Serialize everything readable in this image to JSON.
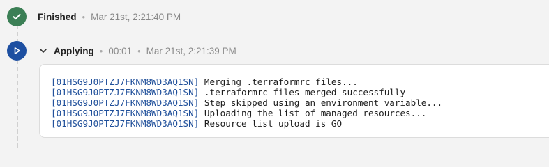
{
  "steps": {
    "finished": {
      "icon": "check-icon",
      "label": "Finished",
      "timestamp": "Mar 21st, 2:21:40 PM"
    },
    "applying": {
      "icon": "play-icon",
      "label": "Applying",
      "duration": "00:01",
      "timestamp": "Mar 21st, 2:21:39 PM",
      "expanded": true
    }
  },
  "log": {
    "lines": [
      {
        "id": "[01HSG9J0PTZJ7FKNM8WD3AQ1SN]",
        "message": "Merging .terraformrc files..."
      },
      {
        "id": "[01HSG9J0PTZJ7FKNM8WD3AQ1SN]",
        "message": ".terraformrc files merged successfully"
      },
      {
        "id": "[01HSG9J0PTZJ7FKNM8WD3AQ1SN]",
        "message": "Step skipped using an environment variable..."
      },
      {
        "id": "[01HSG9J0PTZJ7FKNM8WD3AQ1SN]",
        "message": "Uploading the list of managed resources..."
      },
      {
        "id": "[01HSG9J0PTZJ7FKNM8WD3AQ1SN]",
        "message": "Resource list upload is GO"
      }
    ]
  },
  "colors": {
    "finished": "#3b7f55",
    "applying": "#1d4fa1",
    "log_id": "#1f4f9a"
  }
}
